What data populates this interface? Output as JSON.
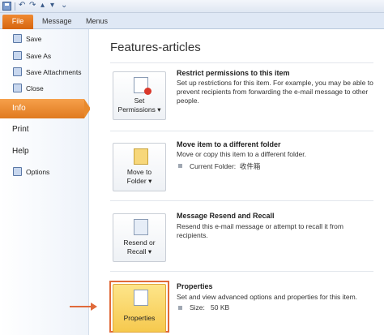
{
  "ribbon": {
    "tabs": [
      "File",
      "Message",
      "Menus"
    ],
    "quick_access_icons": [
      "save-icon",
      "undo-icon",
      "redo-icon",
      "previous-icon",
      "next-icon",
      "dropdown-icon"
    ]
  },
  "nav": {
    "commands": [
      {
        "label": "Save",
        "icon": "save-icon"
      },
      {
        "label": "Save As",
        "icon": "save-as-icon"
      },
      {
        "label": "Save Attachments",
        "icon": "attachment-icon"
      },
      {
        "label": "Close",
        "icon": "close-icon"
      }
    ],
    "selected": "Info",
    "tabs": [
      "Print",
      "Help"
    ],
    "options": {
      "label": "Options",
      "icon": "options-icon"
    }
  },
  "main": {
    "title": "Features-articles",
    "sections": [
      {
        "button_line1": "Set",
        "button_line2": "Permissions",
        "title": "Restrict permissions to this item",
        "description": "Set up restrictions for this item. For example, you may be able to prevent recipients from forwarding the e-mail message to other people."
      },
      {
        "button_line1": "Move to",
        "button_line2": "Folder",
        "title": "Move item to a different folder",
        "description": "Move or copy this item to a different folder.",
        "detail_label": "Current Folder:",
        "detail_value": "收件箱"
      },
      {
        "button_line1": "Resend or",
        "button_line2": "Recall",
        "title": "Message Resend and Recall",
        "description": "Resend this e-mail message or attempt to recall it from recipients."
      },
      {
        "button_line1": "Properties",
        "title": "Properties",
        "description": "Set and view advanced options and properties for this item.",
        "detail_label": "Size:",
        "detail_value": "50 KB"
      }
    ]
  },
  "colors": {
    "file_tab": "#e07a1f",
    "selected_nav": "#f19a44",
    "highlight_frame": "#e06a3a",
    "highlight_button": "#f8d46a"
  }
}
